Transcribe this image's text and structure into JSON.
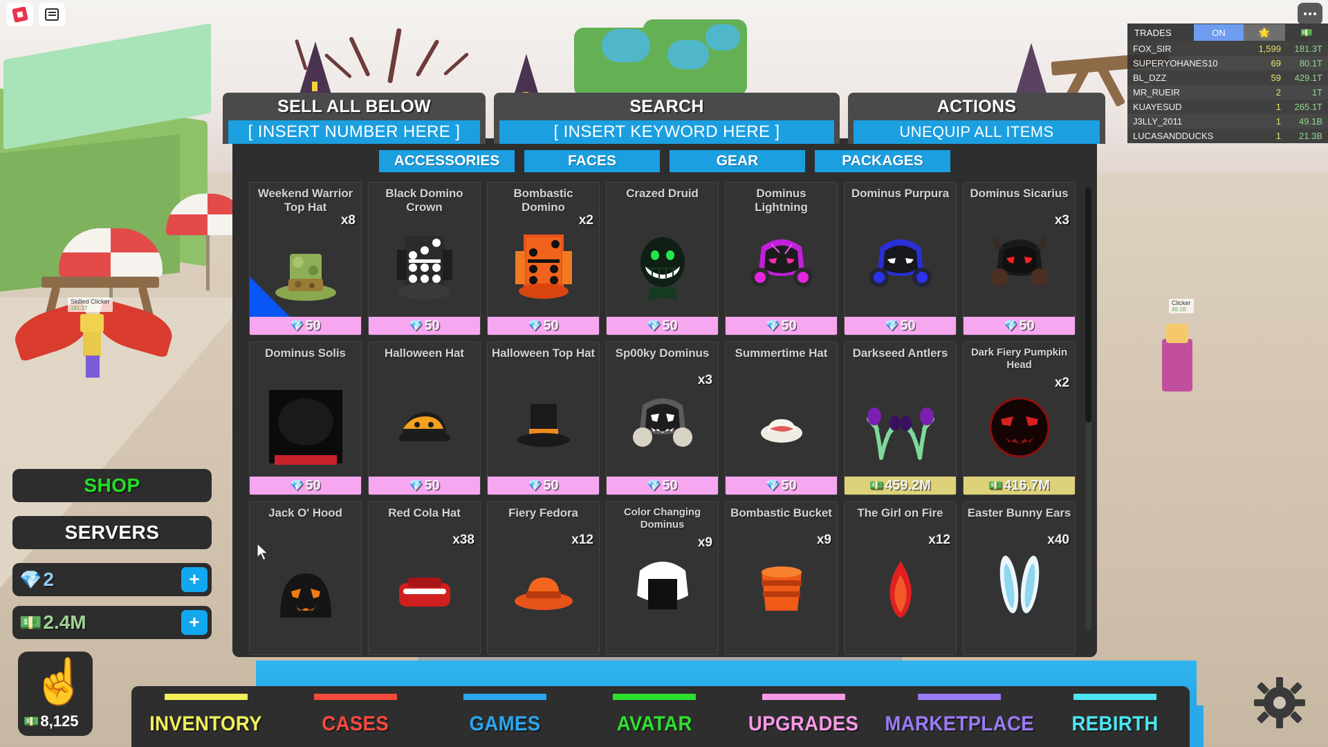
{
  "topbar": {
    "roblox_icon": "roblox-logo-icon",
    "chat_icon": "chat-icon",
    "more_icon": "more-options-icon"
  },
  "leaderboard": {
    "title": "TRADES",
    "toggle_label": "ON",
    "col_icons": [
      "sun-icon",
      "cash-icon"
    ],
    "rows": [
      {
        "name": "FOX_SIR",
        "trades": "1,599",
        "cash": "181.3T"
      },
      {
        "name": "SUPERYOHANES10",
        "trades": "69",
        "cash": "80.1T"
      },
      {
        "name": "BL_DZZ",
        "trades": "59",
        "cash": "429.1T"
      },
      {
        "name": "MR_RUEIR",
        "trades": "2",
        "cash": "1T"
      },
      {
        "name": "KUAYESUD",
        "trades": "1",
        "cash": "265.1T"
      },
      {
        "name": "J3LLY_2011",
        "trades": "1",
        "cash": "49.1B"
      },
      {
        "name": "LUCASANDDUCKS",
        "trades": "1",
        "cash": "21.3B"
      }
    ]
  },
  "left_menu": {
    "shop_label": "SHOP",
    "servers_label": "SERVERS",
    "gems_value": "2",
    "gems_icon": "gem-icon",
    "cash_value": "2.4M",
    "cash_icon": "cash-icon",
    "plus_label": "+",
    "clicker_icon": "pointing-hand-icon",
    "clicker_value": "8,125"
  },
  "controls": {
    "sell": {
      "label": "SELL ALL BELOW",
      "placeholder": "[ INSERT NUMBER HERE ]"
    },
    "search": {
      "label": "SEARCH",
      "placeholder": "[ INSERT KEYWORD HERE ]"
    },
    "actions": {
      "label": "ACTIONS",
      "button": "UNEQUIP ALL ITEMS"
    }
  },
  "inventory": {
    "tabs": [
      {
        "label": "ACCESSORIES",
        "active": true
      },
      {
        "label": "FACES",
        "active": false
      },
      {
        "label": "GEAR",
        "active": false
      },
      {
        "label": "PACKAGES",
        "active": false
      }
    ],
    "items": [
      {
        "name": "Weekend Warrior Top Hat",
        "qty": "x8",
        "price": "50",
        "currency": "gem",
        "art": "weekend-warrior-top-hat",
        "equipped": true
      },
      {
        "name": "Black Domino Crown",
        "qty": "",
        "price": "50",
        "currency": "gem",
        "art": "black-domino-crown"
      },
      {
        "name": "Bombastic Domino",
        "qty": "x2",
        "price": "50",
        "currency": "gem",
        "art": "bombastic-domino"
      },
      {
        "name": "Crazed Druid",
        "qty": "",
        "price": "50",
        "currency": "gem",
        "art": "crazed-druid"
      },
      {
        "name": "Dominus Lightning",
        "qty": "",
        "price": "50",
        "currency": "gem",
        "art": "dominus-lightning"
      },
      {
        "name": "Dominus Purpura",
        "qty": "",
        "price": "50",
        "currency": "gem",
        "art": "dominus-purpura"
      },
      {
        "name": "Dominus Sicarius",
        "qty": "x3",
        "price": "50",
        "currency": "gem",
        "art": "dominus-sicarius"
      },
      {
        "name": "Dominus Solis",
        "qty": "",
        "price": "50",
        "currency": "gem",
        "art": "dominus-solis"
      },
      {
        "name": "Halloween Hat",
        "qty": "",
        "price": "50",
        "currency": "gem",
        "art": "halloween-hat"
      },
      {
        "name": "Halloween Top Hat",
        "qty": "",
        "price": "50",
        "currency": "gem",
        "art": "halloween-top-hat"
      },
      {
        "name": "Sp00ky Dominus",
        "qty": "x3",
        "price": "50",
        "currency": "gem",
        "art": "spooky-dominus"
      },
      {
        "name": "Summertime Hat",
        "qty": "",
        "price": "50",
        "currency": "gem",
        "art": "summertime-hat"
      },
      {
        "name": "Darkseed Antlers",
        "qty": "",
        "price": "459.2M",
        "currency": "cash",
        "art": "darkseed-antlers"
      },
      {
        "name": "Dark Fiery Pumpkin Head",
        "qty": "x2",
        "price": "416.7M",
        "currency": "cash",
        "art": "dark-fiery-pumpkin-head",
        "small_title": true
      },
      {
        "name": "Jack O' Hood",
        "qty": "",
        "price": "",
        "currency": "",
        "art": "jack-o-hood"
      },
      {
        "name": "Red Cola Hat",
        "qty": "x38",
        "price": "",
        "currency": "",
        "art": "red-cola-hat"
      },
      {
        "name": "Fiery Fedora",
        "qty": "x12",
        "price": "",
        "currency": "",
        "art": "fiery-fedora"
      },
      {
        "name": "Color Changing Dominus",
        "qty": "x9",
        "price": "",
        "currency": "",
        "art": "color-changing-dominus",
        "small_title": true
      },
      {
        "name": "Bombastic Bucket",
        "qty": "x9",
        "price": "",
        "currency": "",
        "art": "bombastic-bucket"
      },
      {
        "name": "The Girl on Fire",
        "qty": "x12",
        "price": "",
        "currency": "",
        "art": "the-girl-on-fire"
      },
      {
        "name": "Easter Bunny Ears",
        "qty": "x40",
        "price": "",
        "currency": "",
        "art": "easter-bunny-ears"
      }
    ]
  },
  "bottom_nav": [
    {
      "label": "INVENTORY",
      "color": "#f2ef5a"
    },
    {
      "label": "CASES",
      "color": "#f84a3d"
    },
    {
      "label": "GAMES",
      "color": "#2aa7f0"
    },
    {
      "label": "AVATAR",
      "color": "#2ee02e"
    },
    {
      "label": "UPGRADES",
      "color": "#f79ae8"
    },
    {
      "label": "MARKETPLACE",
      "color": "#9b7af5"
    },
    {
      "label": "REBIRTH",
      "color": "#4be6f2"
    }
  ],
  "world": {
    "player_tag_name": "Skilled Clicker",
    "player_tag_cash": "181.3T",
    "npc_tag_name": "Clicker",
    "npc_tag_cash": "49.1B"
  },
  "colors": {
    "accent_blue": "#1b9fe0",
    "panel_dark": "#2e2e2e",
    "gem_pink": "#f7a6f0",
    "cash_gold": "#ddd27a"
  }
}
